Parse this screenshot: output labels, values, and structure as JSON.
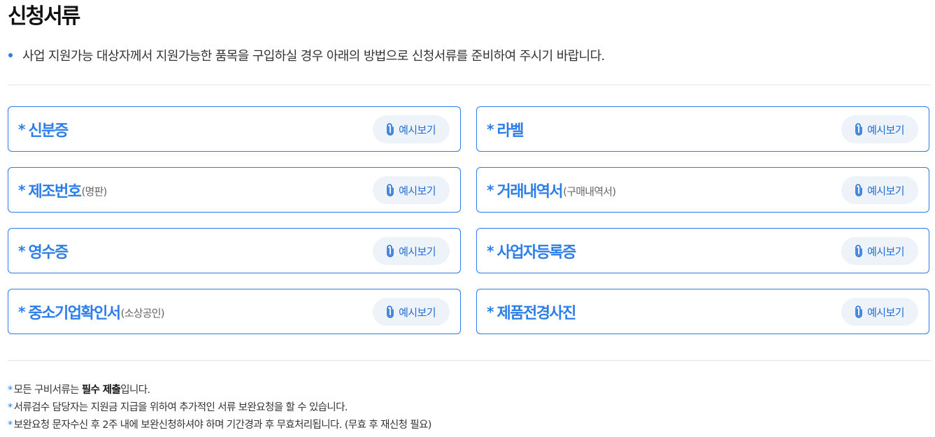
{
  "title": "신청서류",
  "intro": "사업 지원가능 대상자께서 지원가능한 품목을 구입하실 경우 아래의 방법으로 신청서류를 준비하여 주시기 바랍니다.",
  "accent_color": "#2b7de9",
  "required_marker": "*",
  "documents": [
    {
      "name": "신분증",
      "note": "",
      "button_label": "예시보기",
      "icon": "paperclip-icon"
    },
    {
      "name": "라벨",
      "note": "",
      "button_label": "예시보기",
      "icon": "paperclip-icon"
    },
    {
      "name": "제조번호",
      "note": "(명판)",
      "button_label": "예시보기",
      "icon": "paperclip-icon"
    },
    {
      "name": "거래내역서",
      "note": "(구매내역서)",
      "button_label": "예시보기",
      "icon": "paperclip-icon"
    },
    {
      "name": "영수증",
      "note": "",
      "button_label": "예시보기",
      "icon": "paperclip-icon"
    },
    {
      "name": "사업자등록증",
      "note": "",
      "button_label": "예시보기",
      "icon": "paperclip-icon"
    },
    {
      "name": "중소기업확인서",
      "note": "(소상공인)",
      "button_label": "예시보기",
      "icon": "paperclip-icon"
    },
    {
      "name": "제품전경사진",
      "note": "",
      "button_label": "예시보기",
      "icon": "paperclip-icon"
    }
  ],
  "notes": {
    "line1_prefix": "모든 구비서류는 ",
    "line1_strong": "필수 제출",
    "line1_suffix": "입니다.",
    "line2": "서류검수 담당자는 지원금 지급을 위하여 추가적인 서류 보완요청을 할 수 있습니다.",
    "line3": "보완요청 문자수신 후 2주 내에 보완신청하셔야 하며 기간경과 후 무효처리됩니다. (무효 후 재신청 필요)"
  }
}
